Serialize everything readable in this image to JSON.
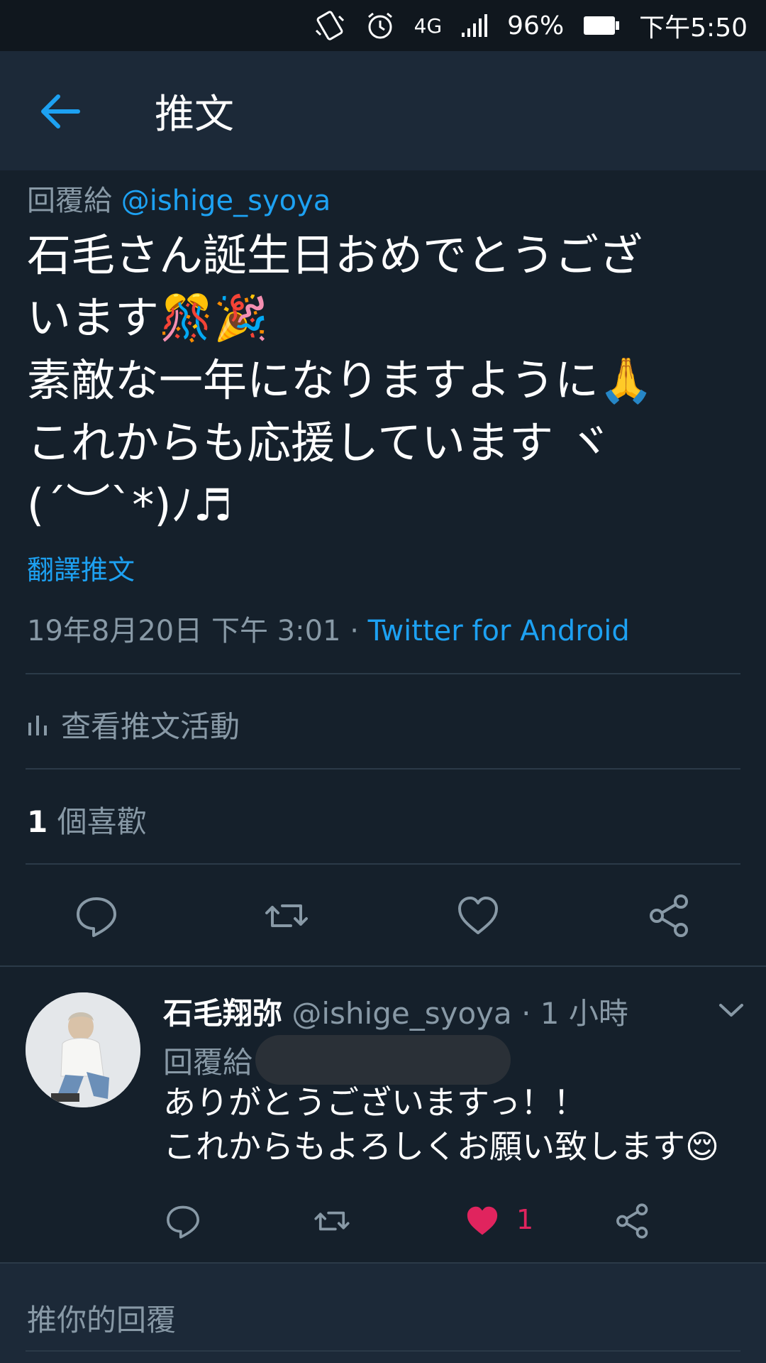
{
  "status_bar": {
    "network": "4G",
    "battery": "96%",
    "time": "下午5:50",
    "icons": [
      "vibrate-icon",
      "alarm-icon",
      "network-4g-icon",
      "signal-icon",
      "battery-icon"
    ]
  },
  "app_bar": {
    "title": "推文",
    "back_icon": "arrow-left-icon"
  },
  "tweet": {
    "reply_to_prefix": "回覆給",
    "reply_to_handle": "@ishige_syoya",
    "text_line1": "石毛さん誕生日おめでとうござ",
    "text_line2": "います🎊🎉",
    "text_line3": "素敵な一年になりますように🙏",
    "text_line4": "これからも応援しています ヾ",
    "text_line5": "(´︶`*)ﾉ♬",
    "translate_label": "翻譯推文",
    "timestamp": "19年8月20日 下午 3:01 · ",
    "source": "Twitter for Android",
    "activity_label": "查看推文活動",
    "likes_count": "1",
    "likes_label": " 個喜歡"
  },
  "reply": {
    "display_name": "石毛翔弥",
    "handle_time": " @ishige_syoya · 1 小時",
    "reply_to_prefix": "回覆給",
    "text_line1": "ありがとうございますっ！！",
    "text_line2": "これからもよろしくお願い致します😌",
    "like_count": "1"
  },
  "compose": {
    "placeholder": "推你的回覆"
  },
  "colors": {
    "background": "#15202b",
    "bar": "#1c2938",
    "accent": "#1da1f2",
    "secondary_text": "#8899a6",
    "like": "#e0245e"
  }
}
